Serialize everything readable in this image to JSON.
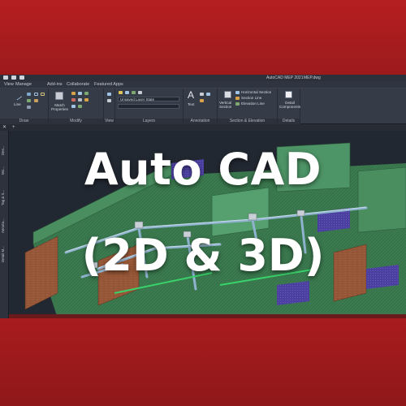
{
  "colors": {
    "brand_red": "#a61d1e",
    "ui_dark": "#1e232b",
    "ribbon": "#353b47",
    "title_text": "#ffffff",
    "floor_green": "#3f7d52",
    "wall_brick": "#9b5a3a",
    "duct_blue": "#8fb3cf"
  },
  "window": {
    "app_title": "AutoCAD MEP 2021",
    "file_name": "MEP.dwg"
  },
  "menu_tabs": [
    "View",
    "Manage",
    "Add-ins",
    "Collaborate",
    "Featured Apps"
  ],
  "ribbon": {
    "draw": {
      "label": "Draw",
      "line": "Line"
    },
    "modify": {
      "label": "Modify",
      "match_properties": "Match\nProperties"
    },
    "view": {
      "label": "View"
    },
    "layers": {
      "label": "Layers",
      "layer_combo": "Unsaved Layer State"
    },
    "annotation": {
      "label": "Annotation",
      "text": "Text"
    },
    "section": {
      "label": "Section & Elevation",
      "vertical_section": "Vertical\nSection",
      "horizontal_section": "Horizontal Section",
      "section_line": "Section Line",
      "elevation_line": "Elevation Line"
    },
    "details": {
      "label": "Details",
      "detail_components": "Detail\nComponents"
    }
  },
  "palette_tabs": [
    "Des...",
    "Mo...",
    "Tag & S...",
    "Annota...",
    "Detail M..."
  ],
  "overlay": {
    "title": "Auto CAD",
    "subtitle": "(2D & 3D)"
  },
  "icons": [
    "quick-access-icon",
    "line-icon",
    "match-properties-icon",
    "text-icon",
    "vertical-section-icon",
    "detail-components-icon",
    "close-tab-icon",
    "new-tab-icon"
  ]
}
